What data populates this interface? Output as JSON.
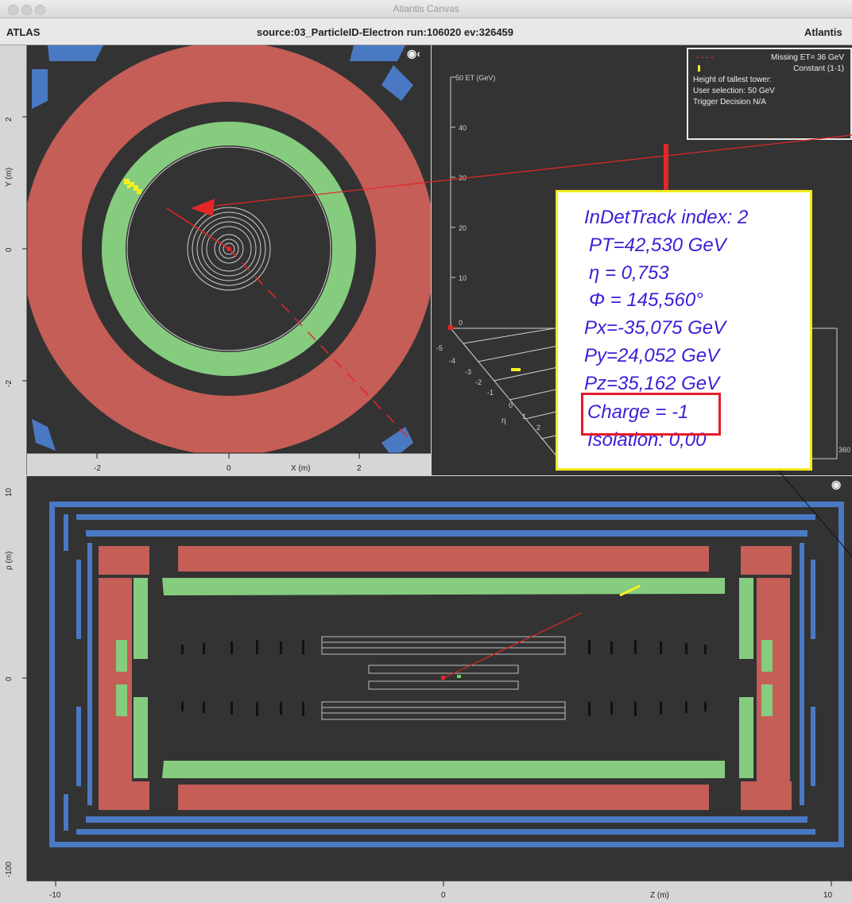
{
  "window": {
    "title": "Atlantis Canvas",
    "app_label": "ATLAS",
    "source_text": "source:03_ParticleID-Electron run:106020 ev:326459",
    "right_label": "Atlantis"
  },
  "icons": {
    "eye": "eye-icon",
    "window_controls": [
      "close-dot",
      "minimize-dot",
      "zoom-dot"
    ]
  },
  "xy_view": {
    "y_axis_label": "Y (m)",
    "x_axis_label": "X (m)",
    "y_ticks": [
      "2",
      "0",
      "-2"
    ],
    "x_ticks": [
      "-2",
      "0",
      "2"
    ]
  },
  "lego_view": {
    "axis_title": "50 ET (GeV)",
    "et_ticks": [
      "40",
      "30",
      "20",
      "10",
      "0"
    ],
    "eta_label": "η",
    "eta_ticks": [
      "-5",
      "-4",
      "-3",
      "-2",
      "-1",
      "0",
      "1",
      "2"
    ],
    "phi_tick": "360",
    "legend": {
      "missing_et": "Missing ET= 36 GeV",
      "constant": "Constant (1-1)",
      "tallest_tower": "Height of tallest tower:",
      "user_selection": "User selection: 50 GeV",
      "trigger": "Trigger Decision N/A"
    }
  },
  "track_info": {
    "title": "InDetTrack index: 2",
    "pt": "PT=42,530 GeV",
    "eta": "η = 0,753",
    "phi": "Φ = 145,560°",
    "px": "Px=-35,075 GeV",
    "py": "Py=24,052 GeV",
    "pz": "Pz=35,162 GeV",
    "charge": "Charge = -1",
    "isolation": "Isolation: 0,00"
  },
  "rz_view": {
    "y_axis_label": "ρ (m)",
    "x_axis_label": "Z (m)",
    "y_ticks": [
      "10",
      "0",
      "-100"
    ],
    "x_ticks": [
      "-10",
      "0",
      "10"
    ]
  },
  "colors": {
    "background": "#333333",
    "muon": "#4a79c4",
    "hadronic": "#c45e57",
    "em": "#86cc7f",
    "track": "#e32626",
    "popup_text": "#3a1fd6",
    "popup_border": "#f2ea1c",
    "highlight": "#e21c2a"
  }
}
